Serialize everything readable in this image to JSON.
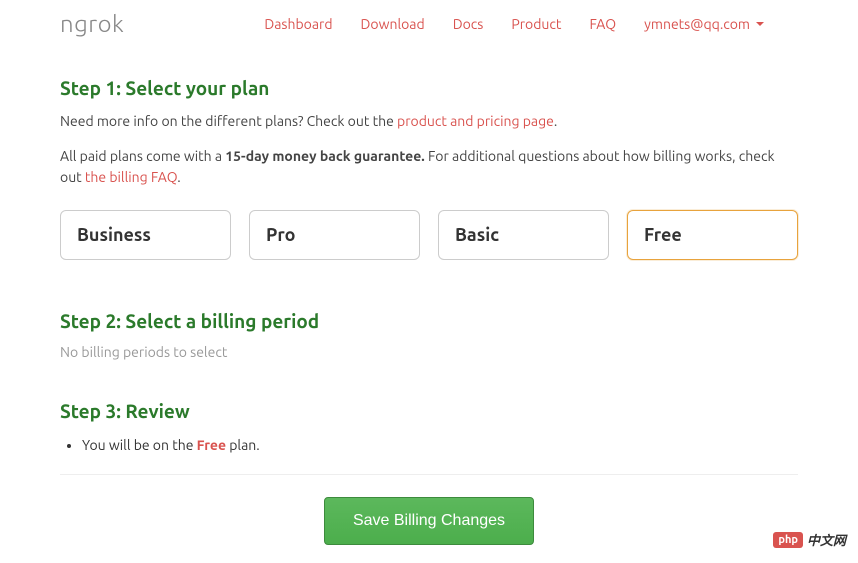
{
  "logo": "ngrok",
  "nav": {
    "dashboard": "Dashboard",
    "download": "Download",
    "docs": "Docs",
    "product": "Product",
    "faq": "FAQ",
    "user": "ymnets@qq.com"
  },
  "step1": {
    "title": "Step 1: Select your plan",
    "desc1_pre": "Need more info on the different plans? Check out the ",
    "desc1_link": "product and pricing page",
    "desc1_post": ".",
    "desc2_pre": "All paid plans come with a ",
    "desc2_bold": "15-day money back guarantee.",
    "desc2_mid": " For additional questions about how billing works, check out ",
    "desc2_link": "the billing FAQ",
    "desc2_post": "."
  },
  "plans": {
    "business": "Business",
    "pro": "Pro",
    "basic": "Basic",
    "free": "Free"
  },
  "step2": {
    "title": "Step 2: Select a billing period",
    "desc": "No billing periods to select"
  },
  "step3": {
    "title": "Step 3: Review",
    "review_pre": "You will be on the ",
    "review_plan": "Free",
    "review_post": " plan."
  },
  "save_button": "Save Billing Changes",
  "watermark": {
    "badge": "php",
    "text": "中文网"
  }
}
